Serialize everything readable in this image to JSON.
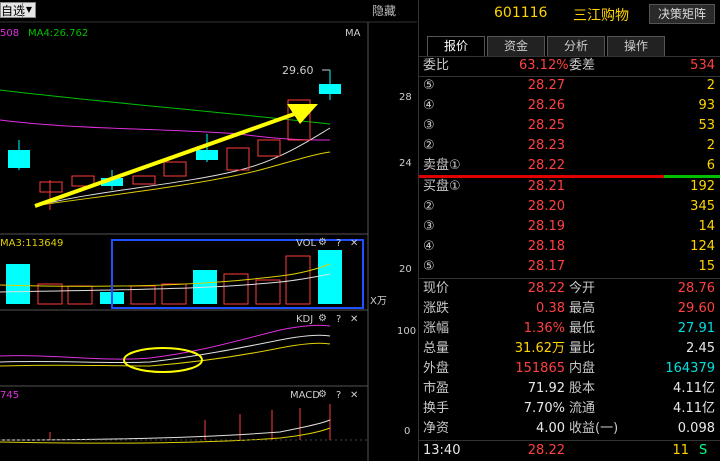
{
  "toolbar": {
    "select_value": "自选",
    "hide_label": "隐藏"
  },
  "chart": {
    "ma_values": {
      "ma3_label": "508",
      "ma4_label": "MA4:26.762",
      "ma_tag": "MA"
    },
    "price_labels": [
      "28",
      "24"
    ],
    "high_marker": "29.60",
    "vol": {
      "ma_label": "MA3:113649",
      "title": "VOL",
      "axis": "20",
      "unit": "X万"
    },
    "kdj": {
      "title": "KDJ",
      "axis": "100"
    },
    "macd": {
      "left_label": "745",
      "title": "MACD",
      "axis": "0"
    },
    "colors": {
      "up": "#ff3c3c",
      "down": "#00ffff",
      "arrow": "#ffff00",
      "box": "#2050ff"
    }
  },
  "quote": {
    "code": "601116",
    "name": "三江购物",
    "tool_button": "决策矩阵",
    "tabs": [
      "报价",
      "资金",
      "分析",
      "操作"
    ],
    "committee": {
      "ratio_label": "委比",
      "ratio": "63.12%",
      "diff_label": "委差",
      "diff": "534"
    },
    "asks": [
      {
        "num": "⑤",
        "price": "28.27",
        "vol": "2"
      },
      {
        "num": "④",
        "price": "28.26",
        "vol": "93"
      },
      {
        "num": "③",
        "price": "28.25",
        "vol": "53"
      },
      {
        "num": "②",
        "price": "28.23",
        "vol": "2"
      },
      {
        "num": "卖盘①",
        "price": "28.22",
        "vol": "6"
      }
    ],
    "bids": [
      {
        "num": "买盘①",
        "price": "28.21",
        "vol": "192"
      },
      {
        "num": "②",
        "price": "28.20",
        "vol": "345"
      },
      {
        "num": "③",
        "price": "28.19",
        "vol": "14"
      },
      {
        "num": "④",
        "price": "28.18",
        "vol": "124"
      },
      {
        "num": "⑤",
        "price": "28.17",
        "vol": "15"
      }
    ],
    "stats": [
      {
        "l1": "现价",
        "v1": "28.22",
        "l2": "今开",
        "v2": "28.76"
      },
      {
        "l1": "涨跌",
        "v1": "0.38",
        "l2": "最高",
        "v2": "29.60"
      },
      {
        "l1": "涨幅",
        "v1": "1.36%",
        "l2": "最低",
        "v2": "27.91"
      },
      {
        "l1": "总量",
        "v1": "31.62万",
        "l2": "量比",
        "v2": "2.45"
      },
      {
        "l1": "外盘",
        "v1": "151865",
        "l2": "内盘",
        "v2": "164379"
      },
      {
        "l1": "市盈",
        "v1": "71.92",
        "l2": "股本",
        "v2": "4.11亿"
      },
      {
        "l1": "换手",
        "v1": "7.70%",
        "l2": "流通",
        "v2": "4.11亿"
      },
      {
        "l1": "净资",
        "v1": "4.00",
        "l2": "收益(一)",
        "v2": "0.098"
      }
    ],
    "tick": {
      "time": "13:40",
      "price": "28.22",
      "vol": "11",
      "dir": "S"
    }
  }
}
